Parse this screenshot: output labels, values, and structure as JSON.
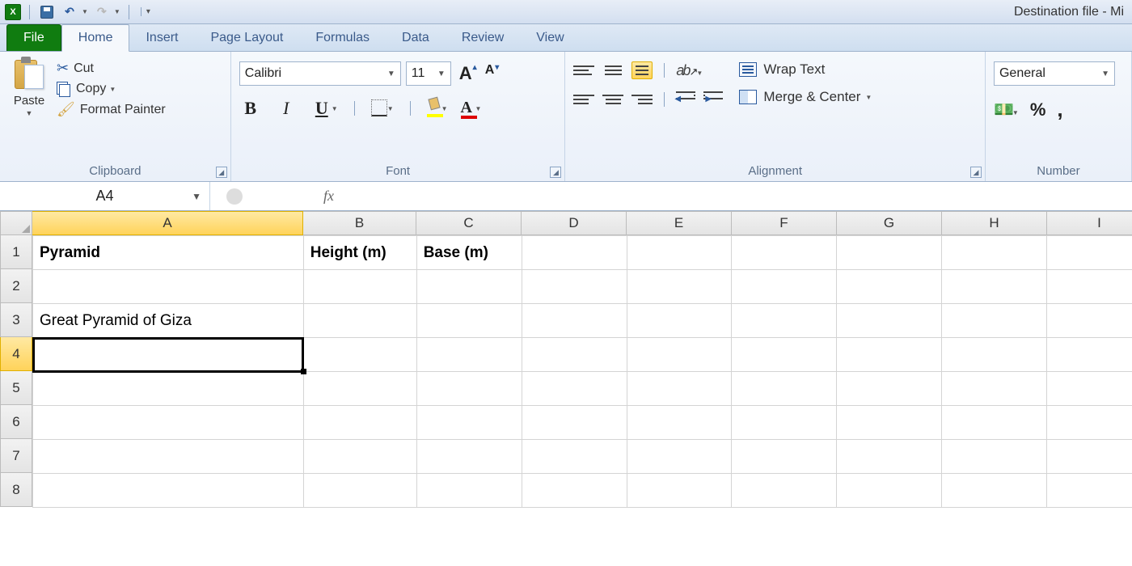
{
  "window_title": "Destination file  -  Mi",
  "tabs": {
    "file": "File",
    "home": "Home",
    "insert": "Insert",
    "page_layout": "Page Layout",
    "formulas": "Formulas",
    "data": "Data",
    "review": "Review",
    "view": "View"
  },
  "clipboard": {
    "paste": "Paste",
    "cut": "Cut",
    "copy": "Copy",
    "format_painter": "Format Painter",
    "group": "Clipboard"
  },
  "font": {
    "name": "Calibri",
    "size": "11",
    "group": "Font"
  },
  "alignment": {
    "wrap": "Wrap Text",
    "merge": "Merge & Center",
    "group": "Alignment"
  },
  "number": {
    "format": "General",
    "group": "Number"
  },
  "namebox": "A4",
  "fx": "fx",
  "columns": [
    "A",
    "B",
    "C",
    "D",
    "E",
    "F",
    "G",
    "H",
    "I"
  ],
  "rows": [
    "1",
    "2",
    "3",
    "4",
    "5",
    "6",
    "7",
    "8"
  ],
  "cells": {
    "A1": "Pyramid",
    "B1": "Height (m)",
    "C1": "Base (m)",
    "A3": "Great Pyramid of Giza"
  },
  "selected_cell": "A4"
}
